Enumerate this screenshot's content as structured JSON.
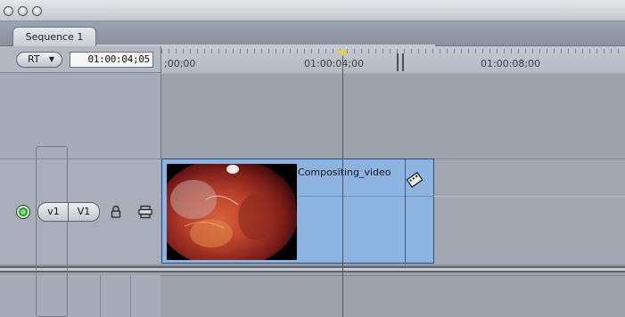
{
  "window": {
    "traffic_lights": [
      "close",
      "minimize",
      "zoom"
    ]
  },
  "tabs": [
    {
      "label": "Sequence 1",
      "active": true
    }
  ],
  "toolbar": {
    "rt_label": "RT",
    "timecode": "01:00:04;05"
  },
  "ruler": {
    "labels": [
      ";00;00",
      "01:00:04;00",
      "01:00:08;00"
    ]
  },
  "track": {
    "source_label": "v1",
    "destination_label": "V1"
  },
  "clip": {
    "name": "Compositing_video"
  },
  "colors": {
    "clip": "#8db3e0",
    "playhead_marker": "#e8d23a",
    "target_on": "#2aa02a"
  }
}
